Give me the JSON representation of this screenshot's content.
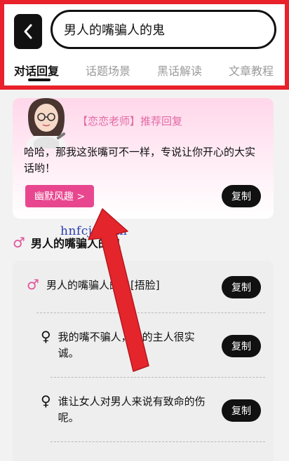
{
  "header": {
    "search_text": "男人的嘴骗人的鬼",
    "tabs": [
      "对话回复",
      "话题场景",
      "黑话解读",
      "文章教程"
    ]
  },
  "recommendation": {
    "title": "【恋恋老师】推荐回复",
    "text": "哈哈，那我这张嘴可不一样，专说让你开心的大实话哟！",
    "tag_label": "幽默风趣 >",
    "copy_label": "复制"
  },
  "watermark": "hnfcjr.com",
  "section_heading": "男人的嘴骗人的鬼",
  "conversation": {
    "items": [
      {
        "gender": "male",
        "icon": "♂",
        "text": "男人的嘴骗人的鬼[捂脸]",
        "copy_label": "复制"
      },
      {
        "gender": "female",
        "icon": "♀",
        "text": "我的嘴不骗人，它的主人很实诚。",
        "copy_label": "复制"
      },
      {
        "gender": "female",
        "icon": "♀",
        "text": "谁让女人对男人来说有致命的伤呢。",
        "copy_label": "复制"
      }
    ]
  },
  "colors": {
    "highlight_border": "#e8212a",
    "accent_pink": "#e8478f",
    "arrow_red": "#e4262c"
  },
  "icons": {
    "back": "back-arrow-icon",
    "male": "male-icon",
    "female": "female-icon"
  }
}
